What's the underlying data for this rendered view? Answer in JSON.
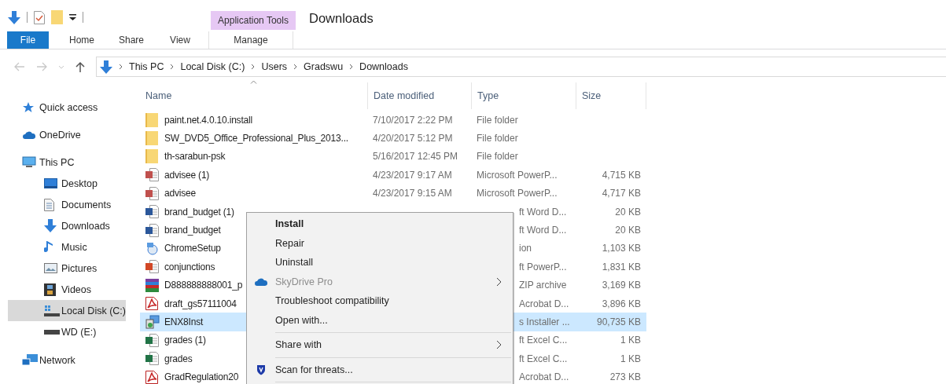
{
  "window": {
    "title": "Downloads"
  },
  "ribbon": {
    "context_group": "Application Tools",
    "tabs": [
      {
        "label": "File",
        "kind": "file",
        "selected": false
      },
      {
        "label": "Home",
        "kind": "tab",
        "selected": false
      },
      {
        "label": "Share",
        "kind": "tab",
        "selected": false
      },
      {
        "label": "View",
        "kind": "tab",
        "selected": false
      },
      {
        "label": "Manage",
        "kind": "contextual",
        "selected": false
      }
    ]
  },
  "address_bar": {
    "path": [
      "This PC",
      "Local Disk (C:)",
      "Users",
      "Gradswu",
      "Downloads"
    ]
  },
  "nav_pane": {
    "items": [
      {
        "label": "Quick access",
        "selected": false
      },
      {
        "label": "OneDrive",
        "selected": false
      },
      {
        "label": "This PC",
        "selected": false,
        "children": [
          {
            "label": "Desktop",
            "selected": false
          },
          {
            "label": "Documents",
            "selected": false
          },
          {
            "label": "Downloads",
            "selected": false
          },
          {
            "label": "Music",
            "selected": false
          },
          {
            "label": "Pictures",
            "selected": false
          },
          {
            "label": "Videos",
            "selected": false
          },
          {
            "label": "Local Disk (C:)",
            "selected": true
          },
          {
            "label": "WD (E:)",
            "selected": false
          }
        ]
      },
      {
        "label": "Network",
        "selected": false
      }
    ]
  },
  "file_list": {
    "columns": [
      "Name",
      "Date modified",
      "Type",
      "Size"
    ],
    "rows": [
      {
        "kind": "folder",
        "name": "paint.net.4.0.10.install",
        "date": "7/10/2017 2:22 PM",
        "type": "File folder",
        "selected": false,
        "under_menu": false
      },
      {
        "kind": "folder",
        "name": "SW_DVD5_Office_Professional_Plus_2013...",
        "date": "4/20/2017 5:12 PM",
        "type": "File folder",
        "selected": false,
        "under_menu": false
      },
      {
        "kind": "folder",
        "name": "th-sarabun-psk",
        "date": "5/16/2017 12:45 PM",
        "type": "File folder",
        "selected": false,
        "under_menu": false
      },
      {
        "kind": "slides",
        "name": "advisee (1)",
        "date": "4/23/2017 9:17 AM",
        "type": "Microsoft PowerP...",
        "size": "4,715 KB",
        "selected": false,
        "under_menu": false
      },
      {
        "kind": "slides",
        "name": "advisee",
        "date": "4/23/2017 9:15 AM",
        "type": "Microsoft PowerP...",
        "size": "4,717 KB",
        "selected": false,
        "under_menu": false
      },
      {
        "kind": "word",
        "name": "brand_budget (1)",
        "type": "ft Word D...",
        "size": "20 KB",
        "selected": false,
        "under_menu": true
      },
      {
        "kind": "word",
        "name": "brand_budget",
        "type": "ft Word D...",
        "size": "20 KB",
        "selected": false,
        "under_menu": true
      },
      {
        "kind": "setup",
        "name": "ChromeSetup",
        "type": "ion",
        "size": "1,103 KB",
        "selected": false,
        "under_menu": true
      },
      {
        "kind": "powerpoint",
        "name": "conjunctions",
        "type": "ft PowerP...",
        "size": "1,831 KB",
        "selected": false,
        "under_menu": true
      },
      {
        "kind": "archive",
        "name": "D888888888001_p",
        "type": "ZIP archive",
        "size": "3,169 KB",
        "selected": false,
        "under_menu": true
      },
      {
        "kind": "pdf",
        "name": "draft_gs57111004",
        "type": "Acrobat D...",
        "size": "3,896 KB",
        "selected": false,
        "under_menu": true
      },
      {
        "kind": "installer",
        "name": "ENX8Inst",
        "type": "s Installer ...",
        "size": "90,735 KB",
        "selected": true,
        "under_menu": true
      },
      {
        "kind": "excel",
        "name": "grades (1)",
        "type": "ft Excel C...",
        "size": "1 KB",
        "selected": false,
        "under_menu": true
      },
      {
        "kind": "excel",
        "name": "grades",
        "type": "ft Excel C...",
        "size": "1 KB",
        "selected": false,
        "under_menu": true
      },
      {
        "kind": "pdf",
        "name": "GradRegulation20",
        "type": "Acrobat D...",
        "size": "273 KB",
        "selected": false,
        "under_menu": true
      }
    ]
  },
  "context_menu": {
    "items": [
      {
        "kind": "item",
        "label": "Install",
        "default": true,
        "disabled": false,
        "submenu": false
      },
      {
        "kind": "item",
        "label": "Repair",
        "default": false,
        "disabled": false,
        "submenu": false
      },
      {
        "kind": "item",
        "label": "Uninstall",
        "default": false,
        "disabled": false,
        "submenu": false
      },
      {
        "kind": "item",
        "label": "SkyDrive Pro",
        "default": false,
        "disabled": true,
        "submenu": true
      },
      {
        "kind": "item",
        "label": "Troubleshoot compatibility",
        "default": false,
        "disabled": false,
        "submenu": false
      },
      {
        "kind": "item",
        "label": "Open with...",
        "default": false,
        "disabled": false,
        "submenu": false
      },
      {
        "kind": "separator"
      },
      {
        "kind": "item",
        "label": "Share with",
        "default": false,
        "disabled": false,
        "submenu": true
      },
      {
        "kind": "separator"
      },
      {
        "kind": "item",
        "label": "Scan for threats...",
        "default": false,
        "disabled": false,
        "submenu": false
      },
      {
        "kind": "separator"
      }
    ]
  }
}
